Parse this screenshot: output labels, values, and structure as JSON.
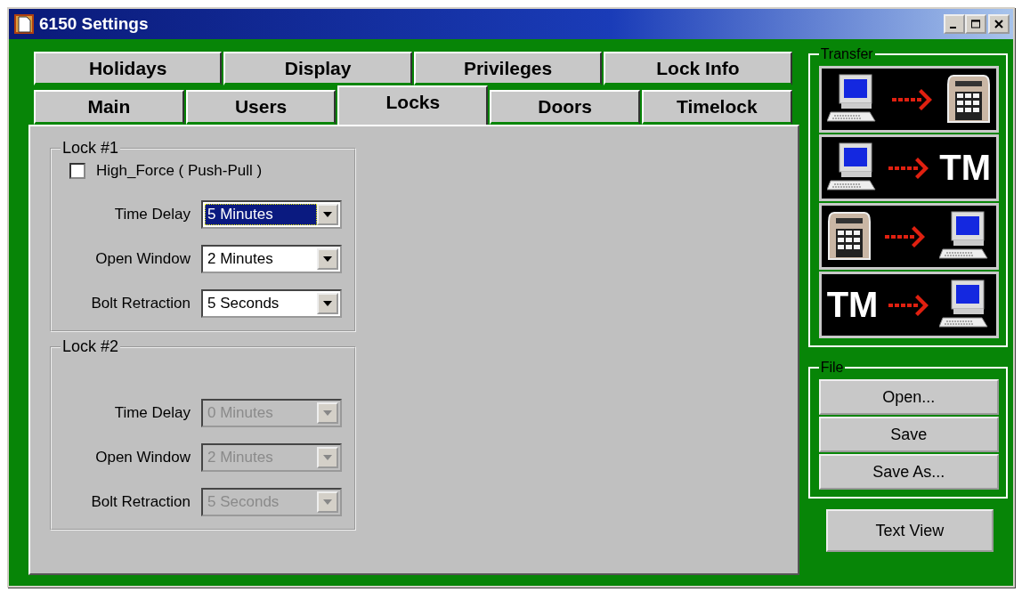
{
  "window": {
    "title": "6150 Settings"
  },
  "tab_rows": [
    {
      "tabs": [
        {
          "label": "Holidays",
          "selected": false
        },
        {
          "label": "Display",
          "selected": false
        },
        {
          "label": "Privileges",
          "selected": false
        },
        {
          "label": "Lock Info",
          "selected": false
        }
      ]
    },
    {
      "tabs": [
        {
          "label": "Main",
          "selected": false
        },
        {
          "label": "Users",
          "selected": false
        },
        {
          "label": "Locks",
          "selected": true
        },
        {
          "label": "Doors",
          "selected": false
        },
        {
          "label": "Timelock",
          "selected": false
        }
      ]
    }
  ],
  "locks": [
    {
      "title": "Lock #1",
      "checkbox": {
        "label": "High_Force ( Push-Pull )",
        "checked": false
      },
      "fields": [
        {
          "label": "Time Delay",
          "value": "5 Minutes",
          "focused": true,
          "disabled": false
        },
        {
          "label": "Open Window",
          "value": "2 Minutes",
          "focused": false,
          "disabled": false
        },
        {
          "label": "Bolt Retraction",
          "value": "5 Seconds",
          "focused": false,
          "disabled": false
        }
      ]
    },
    {
      "title": "Lock #2",
      "fields": [
        {
          "label": "Time Delay",
          "value": "0 Minutes",
          "focused": false,
          "disabled": true
        },
        {
          "label": "Open Window",
          "value": "2 Minutes",
          "focused": false,
          "disabled": true
        },
        {
          "label": "Bolt Retraction",
          "value": "5 Seconds",
          "focused": false,
          "disabled": true
        }
      ]
    }
  ],
  "transfer": {
    "title": "Transfer",
    "buttons": [
      {
        "source": {
          "kind": "computer"
        },
        "target": {
          "kind": "keypad"
        }
      },
      {
        "source": {
          "kind": "computer"
        },
        "target": {
          "kind": "text",
          "label": "TM"
        }
      },
      {
        "source": {
          "kind": "keypad"
        },
        "target": {
          "kind": "computer"
        }
      },
      {
        "source": {
          "kind": "text",
          "label": "TM"
        },
        "target": {
          "kind": "computer"
        }
      }
    ]
  },
  "file": {
    "title": "File",
    "buttons": [
      "Open...",
      "Save",
      "Save As..."
    ]
  },
  "text_view_button": "Text View"
}
